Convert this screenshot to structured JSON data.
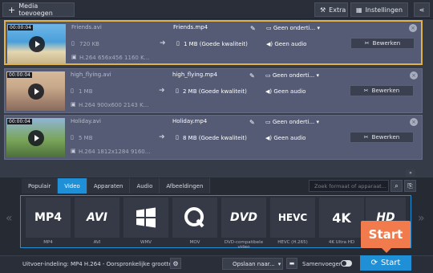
{
  "toolbar": {
    "add_media": "Media toevoegen",
    "extra": "Extra",
    "settings": "Instellingen"
  },
  "files": [
    {
      "timestamp": "00:00:04",
      "source_name": "Friends.avi",
      "source_size": "720 KB",
      "source_codec": "H.264 656x456 1160 K...",
      "output_name": "Friends.mp4",
      "output_quality": "1 MB (Goede kwaliteit)",
      "subtitles": "Geen onderti...",
      "audio": "Geen audio",
      "edit": "Bewerken",
      "selected": true
    },
    {
      "timestamp": "00:00:04",
      "source_name": "high_flying.avi",
      "source_size": "1 MB",
      "source_codec": "H.264 900x600 2143 K...",
      "output_name": "high_flying.mp4",
      "output_quality": "2 MB (Goede kwaliteit)",
      "subtitles": "Geen onderti...",
      "audio": "Geen audio",
      "edit": "Bewerken",
      "selected": false
    },
    {
      "timestamp": "00:00:04",
      "source_name": "Holiday.avi",
      "source_size": "5 MB",
      "source_codec": "H.264 1812x1284 9160...",
      "output_name": "Holiday.mp4",
      "output_quality": "8 MB (Goede kwaliteit)",
      "subtitles": "Geen onderti...",
      "audio": "Geen audio",
      "edit": "Bewerken",
      "selected": false
    }
  ],
  "format_panel": {
    "tabs": [
      "Populair",
      "Video",
      "Apparaten",
      "Audio",
      "Afbeeldingen"
    ],
    "active_tab": "Video",
    "search_placeholder": "Zoek formaat of apparaat...",
    "formats": [
      {
        "logo": "MP4",
        "label": "MP4"
      },
      {
        "logo": "AVI",
        "label": "AVI"
      },
      {
        "logo": "WMV",
        "label": "WMV"
      },
      {
        "logo": "MOV",
        "label": "MOV"
      },
      {
        "logo": "DVD",
        "label": "DVD-compatibele video"
      },
      {
        "logo": "HEVC",
        "label": "HEVC (H.265)"
      },
      {
        "logo": "4K",
        "label": "4K Ultra HD"
      },
      {
        "logo": "HD",
        "label": ""
      }
    ]
  },
  "bottom": {
    "output_format": "Uitvoer-indeling: MP4 H.264 - Oorspronkelijke grootte",
    "save_to": "Opslaan naar...",
    "merge": "Samenvoegen",
    "start": "Start",
    "callout": "Start"
  },
  "colors": {
    "accent": "#1f8fd6",
    "highlight": "#e0b24a",
    "callout": "#f27b4e"
  }
}
